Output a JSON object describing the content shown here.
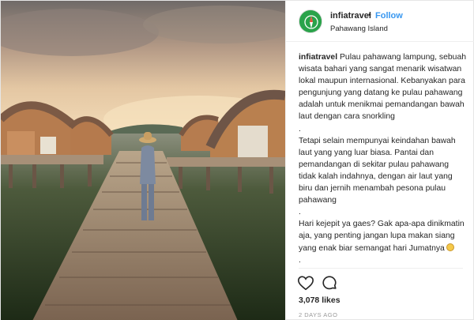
{
  "header": {
    "username": "infiatravel",
    "separator": "•",
    "follow_label": "Follow",
    "location": "Pahawang Island",
    "avatar_icon": "compass-icon"
  },
  "caption": {
    "username": "infiatravel",
    "paragraph1": "Pulau pahawang lampung, sebuah wisata bahari yang sangat menarik wisatwan lokal maupun internasional. Kebanyakan para pengunjung yang datang ke pulau pahawang adalah untuk menikmai pemandangan bawah laut dengan cara snorkling",
    "sep1": ".",
    "paragraph2": "Tetapi selain mempunyai keindahan bawah laut yang yang luar biasa. Pantai dan pemandangan di sekitar pulau pahawang tidak kalah indahnya, dengan air laut yang biru dan jernih menambah pesona pulau pahawang",
    "sep2": ".",
    "paragraph3": "Hari kejepit ya gaes? Gak apa-apa dinikmatin aja, yang penting jangan lupa makan siang yang enak biar semangat hari Jumatnya",
    "sep3": ".",
    "emoji_icon": "smiling-face-emoji"
  },
  "actions": {
    "like_icon": "heart-icon",
    "comment_icon": "comment-icon"
  },
  "likes": "3,078 likes",
  "timestamp": "2 DAYS AGO",
  "colors": {
    "link_blue": "#3897f0",
    "text": "#262626",
    "muted": "#999999",
    "avatar_green": "#2aa34a"
  }
}
